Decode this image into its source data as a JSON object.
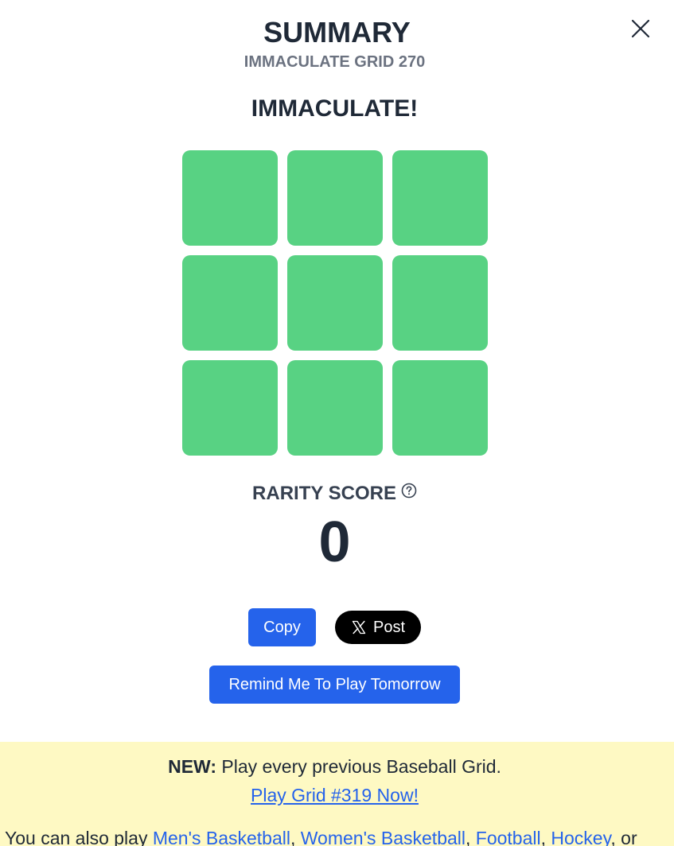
{
  "modal": {
    "title": "SUMMARY",
    "subtitle": "IMMACULATE GRID 270",
    "result_headline": "IMMACULATE!",
    "close_icon": "close-icon"
  },
  "grid": {
    "cell_color": "#58d283",
    "cells": [
      {
        "status": "correct"
      },
      {
        "status": "correct"
      },
      {
        "status": "correct"
      },
      {
        "status": "correct"
      },
      {
        "status": "correct"
      },
      {
        "status": "correct"
      },
      {
        "status": "correct"
      },
      {
        "status": "correct"
      },
      {
        "status": "correct"
      }
    ]
  },
  "rarity": {
    "label": "RARITY SCORE",
    "help_icon": "question-circle-icon",
    "value": "0"
  },
  "actions": {
    "copy_label": "Copy",
    "post_label": "Post",
    "post_icon": "x-logo-icon",
    "remind_label": "Remind Me To Play Tomorrow"
  },
  "promo": {
    "background": "#fef9c3",
    "new_label": "NEW:",
    "new_text": " Play every previous Baseball Grid.",
    "play_link": "Play Grid #319 Now!",
    "also_prefix": "You can also play ",
    "link_mens_basketball": "Men's Basketball",
    "sep1": ", ",
    "link_womens_basketball": "Women's Basketball",
    "sep2": ", ",
    "link_football": "Football",
    "sep3": ", ",
    "link_hockey": "Hockey",
    "suffix": ", or"
  },
  "colors": {
    "accent": "#2563eb",
    "correct": "#58d283",
    "text_dark": "#1f2937",
    "text_muted": "#6b7280"
  }
}
